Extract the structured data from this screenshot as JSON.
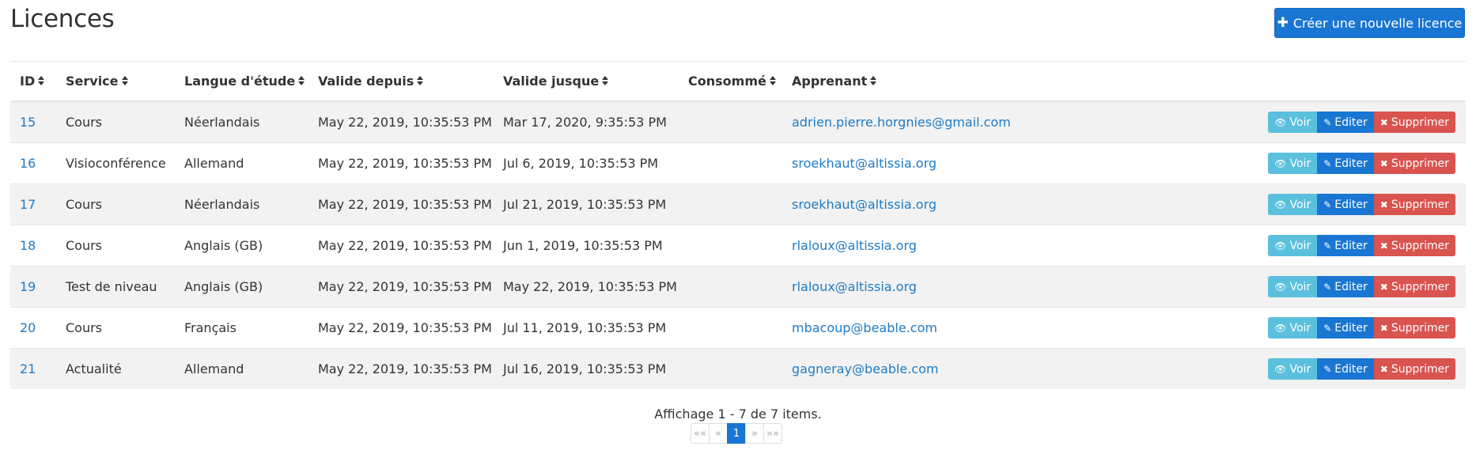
{
  "header": {
    "title": "Licences",
    "create_label": "Créer une nouvelle licence",
    "create_icon": "plus-icon"
  },
  "table": {
    "columns": [
      "ID",
      "Service",
      "Langue d'étude",
      "Valide depuis",
      "Valide jusque",
      "Consommé",
      "Apprenant"
    ],
    "rows": [
      {
        "id": "15",
        "service": "Cours",
        "langue": "Néerlandais",
        "depuis": "May 22, 2019, 10:35:53 PM",
        "jusque": "Mar 17, 2020, 9:35:53 PM",
        "consomme": "",
        "apprenant": "adrien.pierre.horgnies@gmail.com"
      },
      {
        "id": "16",
        "service": "Visioconférence",
        "langue": "Allemand",
        "depuis": "May 22, 2019, 10:35:53 PM",
        "jusque": "Jul 6, 2019, 10:35:53 PM",
        "consomme": "",
        "apprenant": "sroekhaut@altissia.org"
      },
      {
        "id": "17",
        "service": "Cours",
        "langue": "Néerlandais",
        "depuis": "May 22, 2019, 10:35:53 PM",
        "jusque": "Jul 21, 2019, 10:35:53 PM",
        "consomme": "",
        "apprenant": "sroekhaut@altissia.org"
      },
      {
        "id": "18",
        "service": "Cours",
        "langue": "Anglais (GB)",
        "depuis": "May 22, 2019, 10:35:53 PM",
        "jusque": "Jun 1, 2019, 10:35:53 PM",
        "consomme": "",
        "apprenant": "rlaloux@altissia.org"
      },
      {
        "id": "19",
        "service": "Test de niveau",
        "langue": "Anglais (GB)",
        "depuis": "May 22, 2019, 10:35:53 PM",
        "jusque": "May 22, 2019, 10:35:53 PM",
        "consomme": "",
        "apprenant": "rlaloux@altissia.org"
      },
      {
        "id": "20",
        "service": "Cours",
        "langue": "Français",
        "depuis": "May 22, 2019, 10:35:53 PM",
        "jusque": "Jul 11, 2019, 10:35:53 PM",
        "consomme": "",
        "apprenant": "mbacoup@beable.com"
      },
      {
        "id": "21",
        "service": "Actualité",
        "langue": "Allemand",
        "depuis": "May 22, 2019, 10:35:53 PM",
        "jusque": "Jul 16, 2019, 10:35:53 PM",
        "consomme": "",
        "apprenant": "gagneray@beable.com"
      }
    ],
    "actions": {
      "view": "Voir",
      "edit": "Editer",
      "delete": "Supprimer"
    }
  },
  "footer": {
    "summary": "Affichage 1 - 7 de 7 items.",
    "pager": {
      "first": "««",
      "prev": "«",
      "current": "1",
      "next": "»",
      "last": "»»"
    }
  },
  "colors": {
    "primary": "#1976d2",
    "info": "#5bc0de",
    "danger": "#d9534f",
    "link": "#1e7bc6",
    "row_stripe": "#f2f2f2"
  }
}
